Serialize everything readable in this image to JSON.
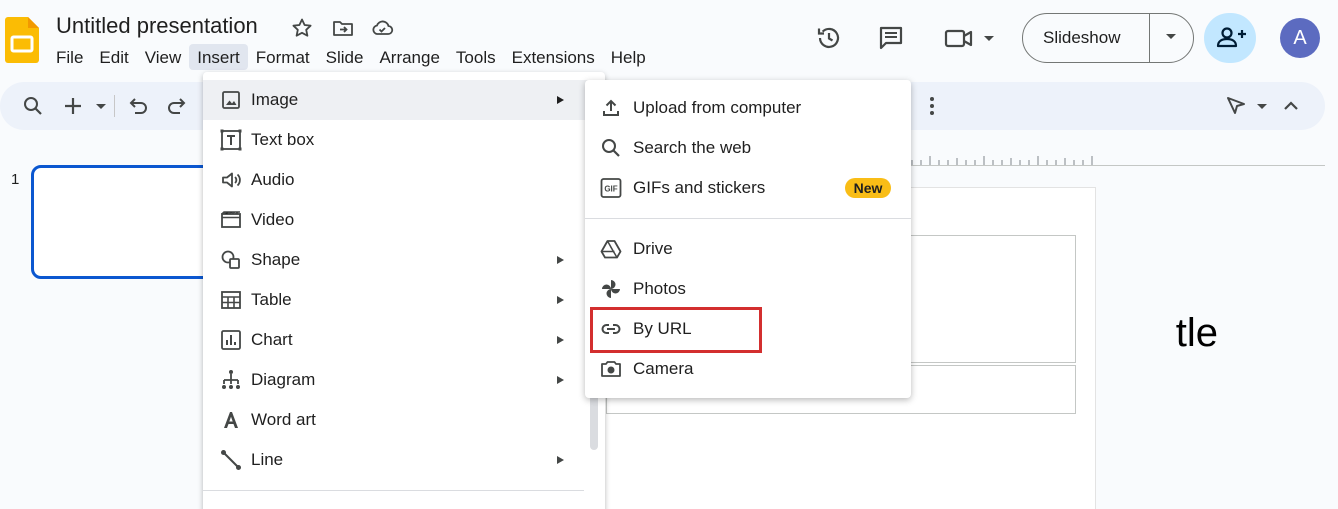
{
  "app": {
    "doc_title": "Untitled presentation",
    "logo_color": "#fbbc04"
  },
  "menubar": {
    "items": [
      "File",
      "Edit",
      "View",
      "Insert",
      "Format",
      "Slide",
      "Arrange",
      "Tools",
      "Extensions",
      "Help"
    ],
    "active": "Insert"
  },
  "header": {
    "slideshow_label": "Slideshow",
    "avatar_letter": "A",
    "share_bg": "#c2e7ff",
    "avatar_bg": "#5c6bc0"
  },
  "filmstrip": {
    "slide_number": "1"
  },
  "slide": {
    "title_fragment": "tle"
  },
  "insert_menu": {
    "items": [
      {
        "label": "Image",
        "icon": "image-icon",
        "submenu": true,
        "highlighted": true
      },
      {
        "label": "Text box",
        "icon": "text-box-icon",
        "submenu": false
      },
      {
        "label": "Audio",
        "icon": "audio-icon",
        "submenu": false
      },
      {
        "label": "Video",
        "icon": "video-icon",
        "submenu": false
      },
      {
        "label": "Shape",
        "icon": "shape-icon",
        "submenu": true
      },
      {
        "label": "Table",
        "icon": "table-icon",
        "submenu": true
      },
      {
        "label": "Chart",
        "icon": "chart-icon",
        "submenu": true
      },
      {
        "label": "Diagram",
        "icon": "diagram-icon",
        "submenu": true
      },
      {
        "label": "Word art",
        "icon": "word-art-icon",
        "submenu": false
      },
      {
        "label": "Line",
        "icon": "line-icon",
        "submenu": true
      }
    ]
  },
  "image_submenu": {
    "items": [
      {
        "label": "Upload from computer",
        "icon": "upload-icon"
      },
      {
        "label": "Search the web",
        "icon": "search-icon"
      },
      {
        "label": "GIFs and stickers",
        "icon": "gif-icon",
        "badge": "New"
      },
      {
        "label": "Drive",
        "icon": "drive-icon"
      },
      {
        "label": "Photos",
        "icon": "photos-icon"
      },
      {
        "label": "By URL",
        "icon": "link-icon",
        "highlighted": true
      },
      {
        "label": "Camera",
        "icon": "camera-icon"
      }
    ],
    "badge_color": "#f9bd16",
    "highlight_color": "#d32f2f"
  }
}
